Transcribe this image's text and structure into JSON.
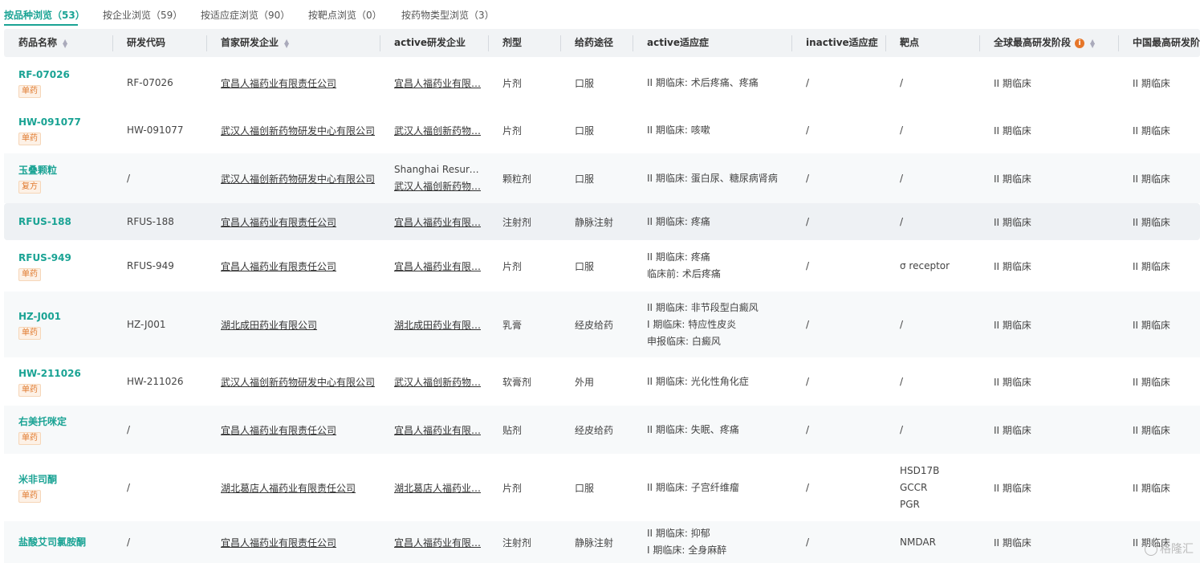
{
  "tabs": [
    {
      "label": "按品种浏览（53）"
    },
    {
      "label": "按企业浏览（59）"
    },
    {
      "label": "按适应症浏览（90）"
    },
    {
      "label": "按靶点浏览（0）"
    },
    {
      "label": "按药物类型浏览（3）"
    }
  ],
  "columns": [
    {
      "label": "药品名称",
      "sortable": true
    },
    {
      "label": "研发代码"
    },
    {
      "label": "首家研发企业",
      "sortable": true
    },
    {
      "label": "active研发企业"
    },
    {
      "label": "剂型"
    },
    {
      "label": "给药途径"
    },
    {
      "label": "active适应症"
    },
    {
      "label": "inactive适应症"
    },
    {
      "label": "靶点"
    },
    {
      "label": "全球最高研发阶段",
      "sortable": true,
      "info": "i"
    },
    {
      "label": "中国最高研发阶段"
    }
  ],
  "rows": [
    {
      "name": "RF-07026",
      "badge": "单药",
      "code": "RF-07026",
      "first_company": "宜昌人福药业有限责任公司",
      "active_company": [
        "宜昌人福药业有限…"
      ],
      "dosage": "片剂",
      "route": "口服",
      "active_ind": [
        "II 期临床: 术后疼痛、疼痛"
      ],
      "inactive_ind": "/",
      "target": [
        "/"
      ],
      "global_phase": "II 期临床",
      "china_phase": "II 期临床"
    },
    {
      "name": "HW-091077",
      "badge": "单药",
      "code": "HW-091077",
      "first_company": "武汉人福创新药物研发中心有限公司",
      "active_company": [
        "武汉人福创新药物…"
      ],
      "dosage": "片剂",
      "route": "口服",
      "active_ind": [
        "II 期临床: 咳嗽"
      ],
      "inactive_ind": "/",
      "target": [
        "/"
      ],
      "global_phase": "II 期临床",
      "china_phase": "II 期临床"
    },
    {
      "name": "玉叠颗粒",
      "badge": "复方",
      "code": "/",
      "first_company": "武汉人福创新药物研发中心有限公司",
      "active_company": [
        "Shanghai Resurr…",
        "武汉人福创新药物…"
      ],
      "dosage": "颗粒剂",
      "route": "口服",
      "active_ind": [
        "II 期临床: 蛋白尿、糖尿病肾病"
      ],
      "inactive_ind": "/",
      "target": [
        "/"
      ],
      "global_phase": "II 期临床",
      "china_phase": "II 期临床"
    },
    {
      "name": "RFUS-188",
      "badge": "",
      "code": "RFUS-188",
      "first_company": "宜昌人福药业有限责任公司",
      "active_company": [
        "宜昌人福药业有限…"
      ],
      "dosage": "注射剂",
      "route": "静脉注射",
      "active_ind": [
        "II 期临床: 疼痛"
      ],
      "inactive_ind": "/",
      "target": [
        "/"
      ],
      "global_phase": "II 期临床",
      "china_phase": "II 期临床"
    },
    {
      "name": "RFUS-949",
      "badge": "单药",
      "code": "RFUS-949",
      "first_company": "宜昌人福药业有限责任公司",
      "active_company": [
        "宜昌人福药业有限…"
      ],
      "dosage": "片剂",
      "route": "口服",
      "active_ind": [
        "II 期临床: 疼痛",
        "临床前: 术后疼痛"
      ],
      "inactive_ind": "/",
      "target": [
        "σ receptor"
      ],
      "global_phase": "II 期临床",
      "china_phase": "II 期临床"
    },
    {
      "name": "HZ-J001",
      "badge": "单药",
      "code": "HZ-J001",
      "first_company": "湖北成田药业有限公司",
      "active_company": [
        "湖北成田药业有限…"
      ],
      "dosage": "乳膏",
      "route": "经皮给药",
      "active_ind": [
        "II 期临床: 非节段型白癜风",
        "I 期临床: 特应性皮炎",
        "申报临床: 白癜风"
      ],
      "inactive_ind": "/",
      "target": [
        "/"
      ],
      "global_phase": "II 期临床",
      "china_phase": "II 期临床"
    },
    {
      "name": "HW-211026",
      "badge": "单药",
      "code": "HW-211026",
      "first_company": "武汉人福创新药物研发中心有限公司",
      "active_company": [
        "武汉人福创新药物…"
      ],
      "dosage": "软膏剂",
      "route": "外用",
      "active_ind": [
        "II 期临床: 光化性角化症"
      ],
      "inactive_ind": "/",
      "target": [
        "/"
      ],
      "global_phase": "II 期临床",
      "china_phase": "II 期临床"
    },
    {
      "name": "右美托咪定",
      "badge": "单药",
      "code": "/",
      "first_company": "宜昌人福药业有限责任公司",
      "active_company": [
        "宜昌人福药业有限…"
      ],
      "dosage": "贴剂",
      "route": "经皮给药",
      "active_ind": [
        "II 期临床: 失眠、疼痛"
      ],
      "inactive_ind": "/",
      "target": [
        "/"
      ],
      "global_phase": "II 期临床",
      "china_phase": "II 期临床"
    },
    {
      "name": "米非司酮",
      "badge": "单药",
      "code": "/",
      "first_company": "湖北葛店人福药业有限责任公司",
      "active_company": [
        "湖北葛店人福药业…"
      ],
      "dosage": "片剂",
      "route": "口服",
      "active_ind": [
        "II 期临床: 子宫纤维瘤"
      ],
      "inactive_ind": "/",
      "target": [
        "HSD17B",
        "GCCR",
        "PGR"
      ],
      "global_phase": "II 期临床",
      "china_phase": "II 期临床"
    },
    {
      "name": "盐酸艾司氯胺酮",
      "badge": "",
      "code": "/",
      "first_company": "宜昌人福药业有限责任公司",
      "active_company": [
        "宜昌人福药业有限…"
      ],
      "dosage": "注射剂",
      "route": "静脉注射",
      "active_ind": [
        "II 期临床: 抑郁",
        "I 期临床: 全身麻醉"
      ],
      "inactive_ind": "/",
      "target": [
        "NMDAR"
      ],
      "global_phase": "II 期临床",
      "china_phase": "II 期临床"
    }
  ],
  "watermark": "格隆汇",
  "colors": {
    "accent": "#1aa394",
    "badge": "#e07a2f",
    "header_bg": "#f1f3f5",
    "info_icon": "#e6762a"
  }
}
